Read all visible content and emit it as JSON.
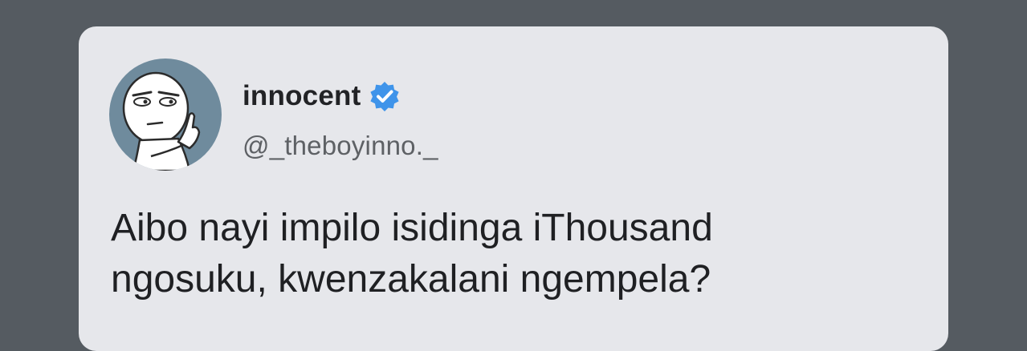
{
  "tweet": {
    "author": {
      "display_name": "innocent",
      "handle": "@_theboyinno._",
      "verified": true,
      "avatar_icon": "meme-face-avatar-icon"
    },
    "text_lines": [
      "Aibo nayi impilo isidinga iThousand",
      "ngosuku, kwenzakalani ngempela?"
    ]
  },
  "colors": {
    "background": "#555b61",
    "card": "#e6e7eb",
    "verified_badge": "#3f94ea",
    "avatar_bg": "#6f8b9d"
  }
}
